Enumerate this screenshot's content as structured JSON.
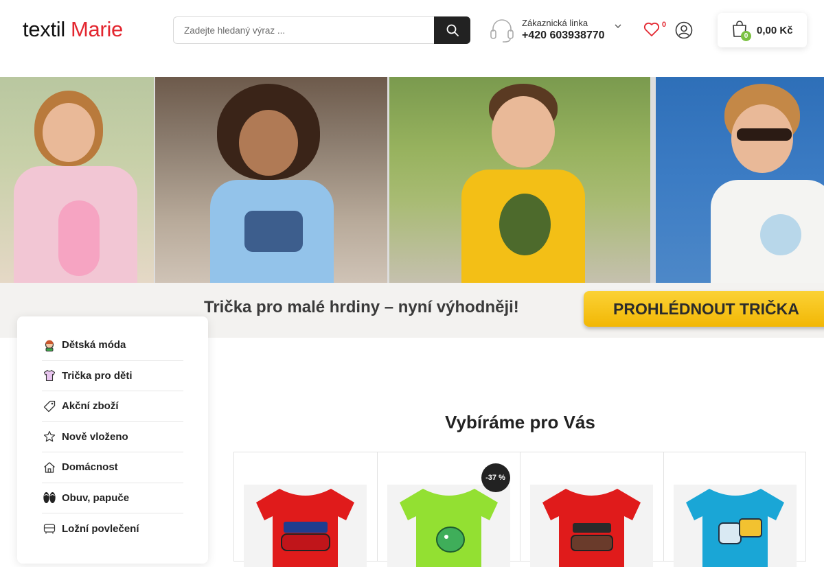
{
  "header": {
    "logo_part1": "textil",
    "logo_part2": "Marie",
    "search_placeholder": "Zadejte hledaný výraz ...",
    "support_label": "Zákaznická linka",
    "support_phone": "+420 603938770",
    "wishlist_count": "0",
    "cart_count": "0",
    "cart_total": "0,00 Kč"
  },
  "hero": {
    "tagline": "Trička pro malé hrdiny – nyní výhodněji!",
    "cta": "PROHLÉDNOUT TRIČKA"
  },
  "sidebar": {
    "items": [
      {
        "label": "Dětská móda",
        "icon": "child-icon"
      },
      {
        "label": "Trička pro děti",
        "icon": "tshirt-icon"
      },
      {
        "label": "Akční zboží",
        "icon": "tag-icon"
      },
      {
        "label": "Nově vloženo",
        "icon": "star-icon"
      },
      {
        "label": "Domácnost",
        "icon": "home-icon"
      },
      {
        "label": "Obuv, papuče",
        "icon": "flip-flops-icon"
      },
      {
        "label": "Ložní povlečení",
        "icon": "bed-icon"
      }
    ]
  },
  "recommendations": {
    "title": "Vybíráme pro Vás",
    "products": [
      {
        "color": "#e01b1b",
        "print": "race car"
      },
      {
        "color": "#93e032",
        "print": "dinosaur",
        "discount": "-37 %"
      },
      {
        "color": "#e01b1b",
        "print": "monster truck"
      },
      {
        "color": "#1aa6d6",
        "print": "truck"
      }
    ]
  }
}
